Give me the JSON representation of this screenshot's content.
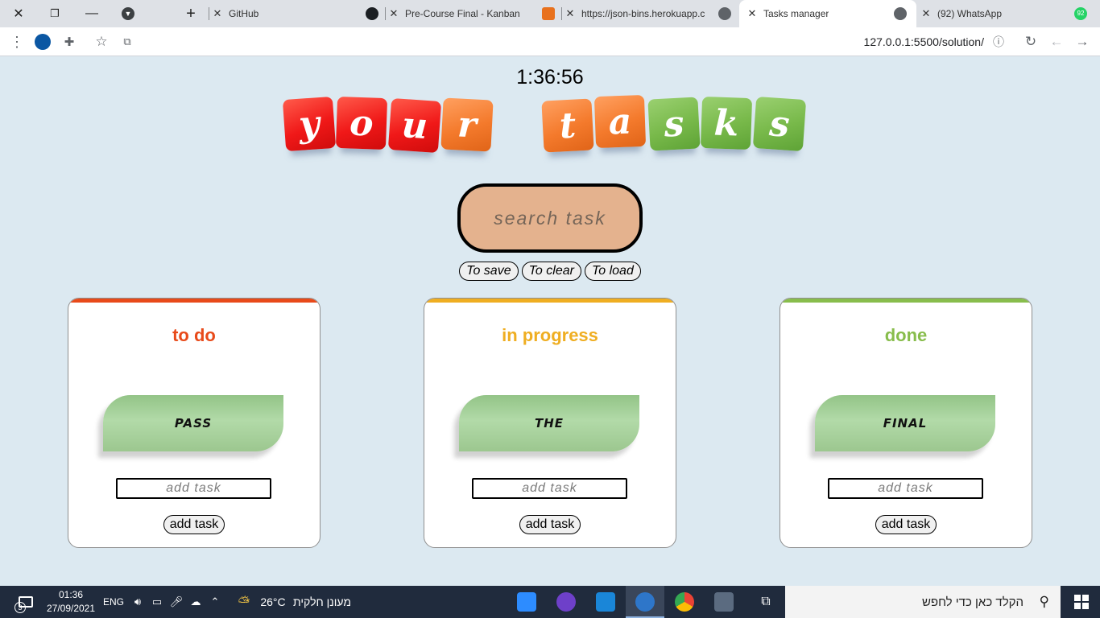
{
  "browser": {
    "tabs": [
      {
        "title": "GitHub",
        "active": false
      },
      {
        "title": "Pre-Course Final - Kanban",
        "active": false
      },
      {
        "title": "https://json-bins.herokuapp.c",
        "active": false
      },
      {
        "title": "Tasks manager",
        "active": true
      },
      {
        "title": "(92) WhatsApp",
        "active": false
      }
    ],
    "whatsapp_badge": "92",
    "url": "127.0.0.1:5500/solution/"
  },
  "page": {
    "clock": "1:36:56",
    "logo_word1": [
      "y",
      "o",
      "u",
      "r"
    ],
    "logo_word2": [
      "t",
      "a",
      "s",
      "k",
      "s"
    ],
    "search_placeholder": "search task",
    "actions": {
      "save": "To save",
      "clear": "To clear",
      "load": "To load"
    },
    "columns": [
      {
        "title": "to do",
        "color": "#e84a1a",
        "task": "PASS",
        "input_placeholder": "add task",
        "button": "add task"
      },
      {
        "title": "in progress",
        "color": "#efae22",
        "task": "THE",
        "input_placeholder": "add task",
        "button": "add task"
      },
      {
        "title": "done",
        "color": "#88bd4c",
        "task": "FINAL",
        "input_placeholder": "add task",
        "button": "add task"
      }
    ]
  },
  "taskbar": {
    "notifications": "3",
    "time": "01:36",
    "date": "27/09/2021",
    "lang": "ENG",
    "temperature": "26°C",
    "weather": "מעונן חלקית",
    "search_placeholder": "הקלד כאן כדי לחפש"
  }
}
